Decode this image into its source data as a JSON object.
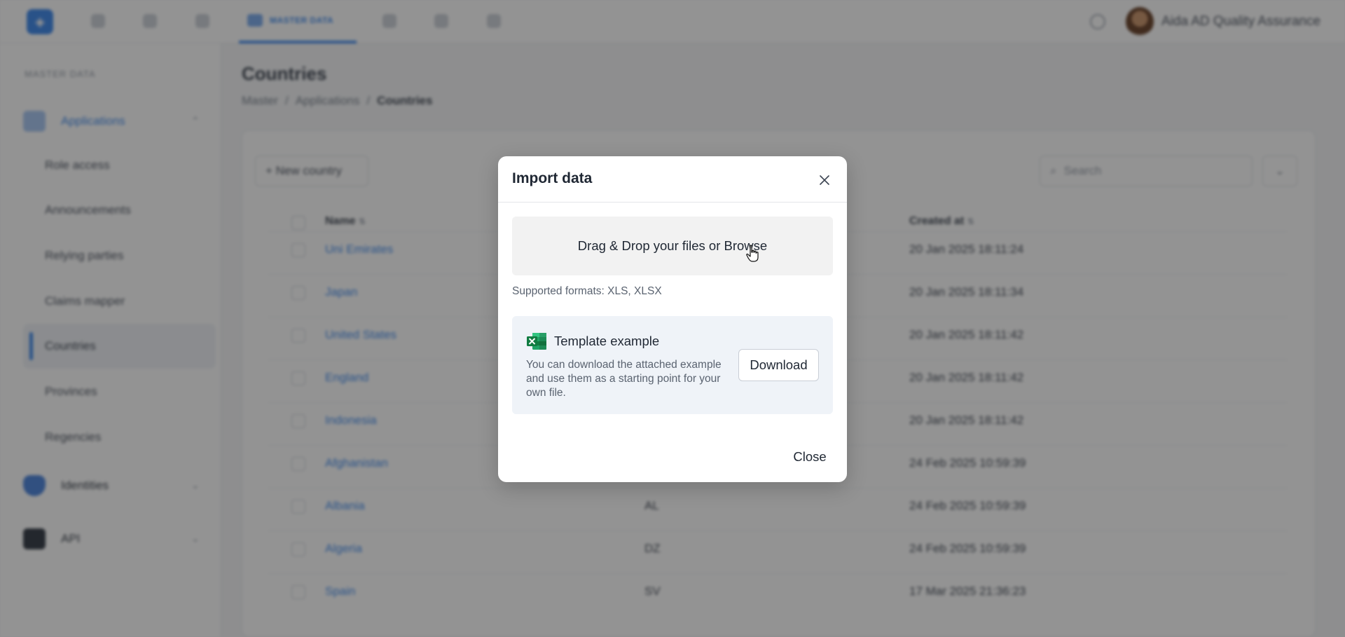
{
  "topbar": {
    "active_tab": "MASTER DATA",
    "user_name": "Aida AD Quality Assurance"
  },
  "sidebar": {
    "section_label": "MASTER DATA",
    "groups": [
      {
        "label": "Applications",
        "icon": "applications-icon"
      },
      {
        "label": "Identities",
        "icon": "shield-icon"
      },
      {
        "label": "API",
        "icon": "api-icon"
      }
    ],
    "items": [
      "Role access",
      "Announcements",
      "Relying parties",
      "Claims mapper",
      "Countries",
      "Provinces",
      "Regencies"
    ],
    "active_item": "Countries"
  },
  "main": {
    "title": "Countries",
    "breadcrumb": [
      "Master",
      "Applications",
      "Countries"
    ],
    "new_button": "+ New country",
    "search_placeholder": "Search",
    "columns": {
      "name": "Name",
      "created_at": "Created at"
    },
    "rows": [
      {
        "name": "Uni Emirates",
        "code": "",
        "created": "20 Jan 2025 18:11:24"
      },
      {
        "name": "Japan",
        "code": "",
        "created": "20 Jan 2025 18:11:34"
      },
      {
        "name": "United States",
        "code": "",
        "created": "20 Jan 2025 18:11:42"
      },
      {
        "name": "England",
        "code": "",
        "created": "20 Jan 2025 18:11:42"
      },
      {
        "name": "Indonesia",
        "code": "",
        "created": "20 Jan 2025 18:11:42"
      },
      {
        "name": "Afghanistan",
        "code": "",
        "created": "24 Feb 2025 10:59:39"
      },
      {
        "name": "Albania",
        "code": "AL",
        "created": "24 Feb 2025 10:59:39"
      },
      {
        "name": "Algeria",
        "code": "DZ",
        "created": "24 Feb 2025 10:59:39"
      },
      {
        "name": "Spain",
        "code": "SV",
        "created": "17 Mar 2025 21:36:23"
      }
    ]
  },
  "modal": {
    "title": "Import data",
    "dropzone_text": "Drag & Drop your files or Browse",
    "formats_text": "Supported formats: XLS, XLSX",
    "template_title": "Template example",
    "template_desc": "You can download the attached example and use them as a starting point for your own file.",
    "download_label": "Download",
    "close_label": "Close"
  },
  "colors": {
    "accent": "#2b7de9",
    "overlay": "rgba(40,40,40,0.5)",
    "excel_green": "#1d7044"
  }
}
